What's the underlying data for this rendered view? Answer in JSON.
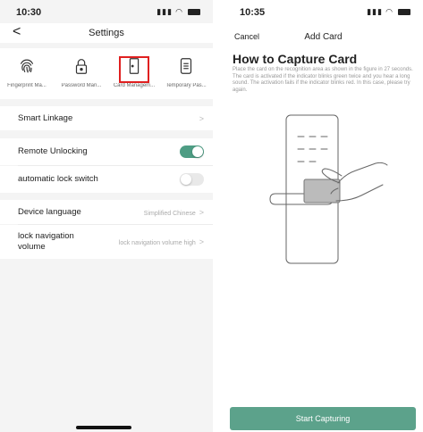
{
  "left": {
    "status": {
      "time": "10:30",
      "signal": "...",
      "wifi": "wifi"
    },
    "nav": {
      "back": "<",
      "title": "Settings"
    },
    "tools": [
      {
        "label": "Fingerprint Ma...",
        "icon": "fingerprint-icon"
      },
      {
        "label": "Password Man...",
        "icon": "lock-icon"
      },
      {
        "label": "Card Managem...",
        "icon": "card-door-icon",
        "selected": true
      },
      {
        "label": "Temporary Pas...",
        "icon": "keypad-icon"
      }
    ],
    "rows": {
      "smart_linkage": {
        "label": "Smart Linkage",
        "chevron": ">"
      },
      "remote_unlocking": {
        "label": "Remote Unlocking",
        "on": true
      },
      "auto_lock": {
        "label": "automatic lock switch",
        "on": false
      },
      "device_language": {
        "label": "Device language",
        "value": "Simplified Chinese",
        "chevron": ">"
      },
      "nav_volume": {
        "label": "lock navigation volume",
        "value": "lock navigation volume high",
        "chevron": ">"
      }
    },
    "colors": {
      "accent": "#4e9d84",
      "highlight": "#e02020"
    }
  },
  "right": {
    "status": {
      "time": "10:35",
      "signal": "...",
      "wifi": "wifi"
    },
    "nav": {
      "cancel": "Cancel",
      "title": "Add Card"
    },
    "heading": "How to Capture Card",
    "description": "Place the card on the recognition area as shown in the figure in 27 seconds. The card is activated if the indicator blinks green twice and you hear a long sound. The activation fails if the indicator blinks red. In this case, please try again.",
    "illustration_icon": "hand-card-on-lock-icon",
    "cta": "Start Capturing",
    "colors": {
      "cta": "#5ca28b"
    }
  }
}
